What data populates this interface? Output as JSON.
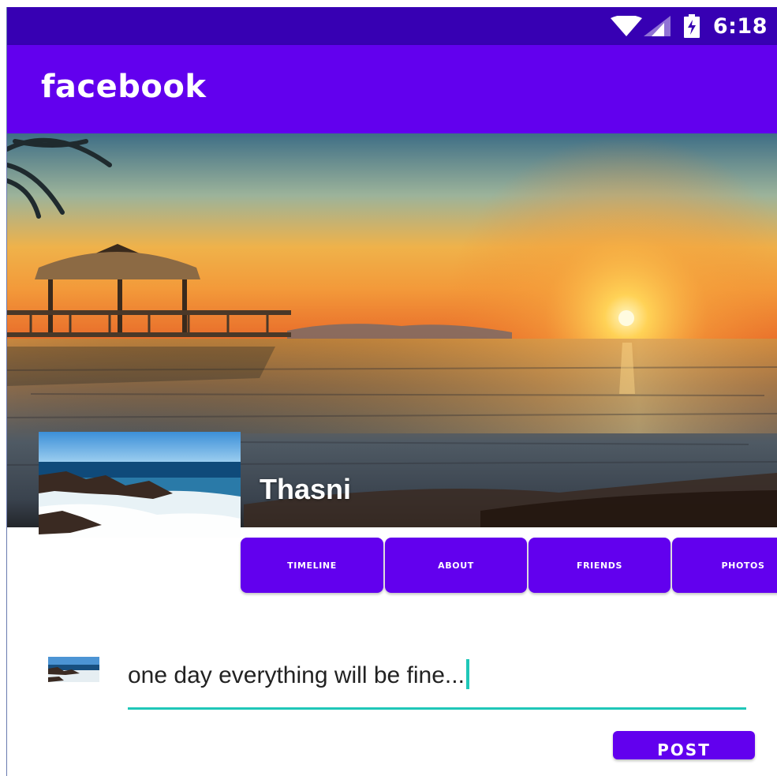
{
  "status_bar": {
    "time": "6:18",
    "icons": [
      "wifi-icon",
      "cellular-signal-icon",
      "battery-charging-icon"
    ],
    "color": "#3700b3"
  },
  "app_bar": {
    "title": "facebook",
    "color": "#6200ee"
  },
  "profile": {
    "name": "Thasni",
    "cover_image": "beach-sunset-image",
    "profile_image": "ocean-rocks-image"
  },
  "tabs": [
    {
      "label": "TIMELINE"
    },
    {
      "label": "ABOUT"
    },
    {
      "label": "FRIENDS"
    },
    {
      "label": "PHOTOS"
    }
  ],
  "compose": {
    "value": "one day everything will be fine...",
    "accent": "#1fc7b8"
  },
  "post_button": {
    "label": "POST"
  }
}
